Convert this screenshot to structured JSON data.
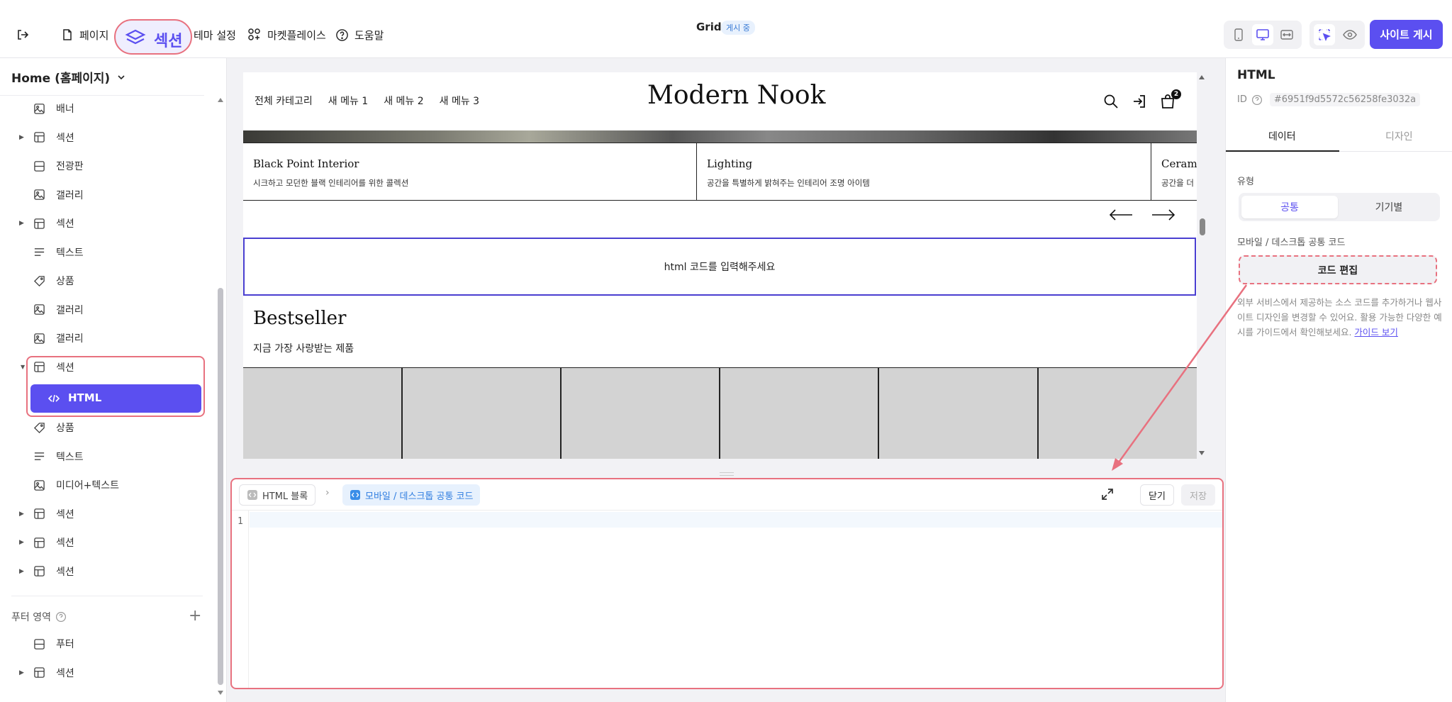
{
  "header": {
    "back_icon": "exit-icon",
    "page_label": "페이지",
    "section_label": "섹션",
    "theme_label": "테마 설정",
    "marketplace_label": "마켓플레이스",
    "help_label": "도움말",
    "site_title": "Grid",
    "status_badge": "게시 중",
    "publish_button": "사이트 게시",
    "accent_color": "#5b4ff0"
  },
  "sidebar": {
    "page_select": "Home (홈페이지)",
    "items": [
      {
        "label": "배너",
        "icon": "image-icon",
        "caret": false
      },
      {
        "label": "섹션",
        "icon": "layout-icon",
        "caret": true
      },
      {
        "label": "전광판",
        "icon": "board-icon",
        "caret": false
      },
      {
        "label": "갤러리",
        "icon": "image-icon",
        "caret": false
      },
      {
        "label": "섹션",
        "icon": "layout-icon",
        "caret": true
      },
      {
        "label": "텍스트",
        "icon": "text-icon",
        "caret": false
      },
      {
        "label": "상품",
        "icon": "tag-icon",
        "caret": false
      },
      {
        "label": "갤러리",
        "icon": "image-icon",
        "caret": false
      },
      {
        "label": "갤러리",
        "icon": "image-icon",
        "caret": false
      },
      {
        "label": "섹션",
        "icon": "layout-icon",
        "caret": true
      }
    ],
    "selected_child": "HTML",
    "items_after": [
      {
        "label": "상품",
        "icon": "tag-icon",
        "caret": false
      },
      {
        "label": "텍스트",
        "icon": "text-icon",
        "caret": false
      },
      {
        "label": "미디어+텍스트",
        "icon": "image-icon",
        "caret": false
      },
      {
        "label": "섹션",
        "icon": "layout-icon",
        "caret": true
      },
      {
        "label": "섹션",
        "icon": "layout-icon",
        "caret": true
      },
      {
        "label": "섹션",
        "icon": "layout-icon",
        "caret": true
      }
    ],
    "footer_area_label": "푸터 영역",
    "footer_items": [
      {
        "label": "푸터",
        "icon": "board-icon",
        "caret": false
      },
      {
        "label": "섹션",
        "icon": "layout-icon",
        "caret": true
      }
    ]
  },
  "preview": {
    "nav": [
      "전체 카테고리",
      "새 메뉴 1",
      "새 메뉴 2",
      "새 메뉴 3"
    ],
    "logo": "Modern Nook",
    "cart_count": "2",
    "cards": [
      {
        "title": "Black Point Interior",
        "subtitle": "시크하고 모던한 블랙 인테리어를 위한 콜렉션"
      },
      {
        "title": "Lighting",
        "subtitle": "공간을 특별하게 밝혀주는 인테리어 조명 아이템"
      },
      {
        "title": "Ceramic",
        "subtitle": "공간을 더"
      }
    ],
    "html_placeholder": "html 코드를 입력해주세요",
    "bestseller_title": "Bestseller",
    "bestseller_subtitle": "지금 가장 사랑받는 제품"
  },
  "editor": {
    "crumb_block": "HTML 블록",
    "crumb_code": "모바일 / 데스크톱 공통 코드",
    "close_label": "닫기",
    "save_label": "저장",
    "line_number": "1"
  },
  "right_panel": {
    "title": "HTML",
    "id_label": "ID",
    "id_value": "#6951f9d5572c56258fe3032a",
    "tab_data": "데이터",
    "tab_design": "디자인",
    "type_label": "유형",
    "type_common": "공통",
    "type_device": "기기별",
    "code_label": "모바일 / 데스크톱 공통 코드",
    "code_edit_button": "코드 편집",
    "description": "외부 서비스에서 제공하는 소스 코드를 추가하거나 웹사이트 디자인을 변경할 수 있어요. 활용 가능한 다양한 예시를 가이드에서 확인해보세요.",
    "guide_link": "가이드 보기"
  },
  "annotation_color": "#e8717f"
}
